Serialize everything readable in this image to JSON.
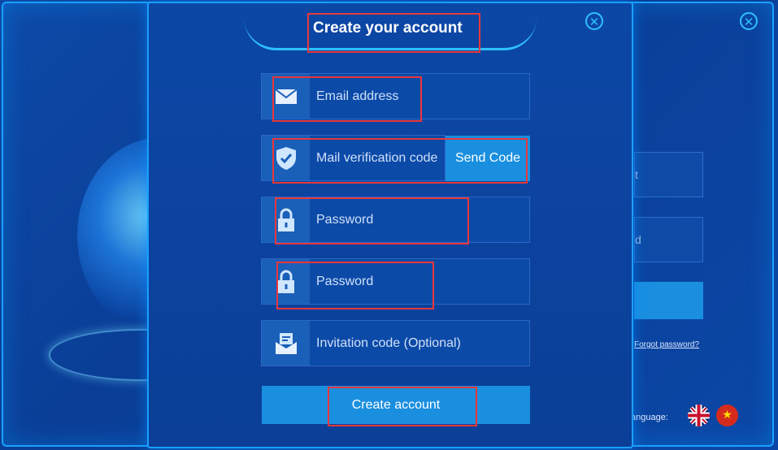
{
  "modal": {
    "title": "Create your account",
    "fields": [
      {
        "placeholder": "Email address",
        "icon": "envelope-icon"
      },
      {
        "placeholder": "Mail verification code",
        "icon": "shield-check-icon"
      },
      {
        "placeholder": "Password",
        "icon": "lock-icon"
      },
      {
        "placeholder": "Password",
        "icon": "lock-icon"
      },
      {
        "placeholder": "Invitation code (Optional)",
        "icon": "invitation-icon"
      }
    ],
    "send_code_label": "Send Code",
    "create_label": "Create account",
    "close_icon": "close-icon"
  },
  "background": {
    "forgot_label": "Forgot password?",
    "language_label": "anguage:",
    "field_fragment_1": "t",
    "field_fragment_2": "d"
  },
  "colors": {
    "accent": "#1a8fe0",
    "frame": "#1aa0ff",
    "highlight": "#e8373a"
  }
}
